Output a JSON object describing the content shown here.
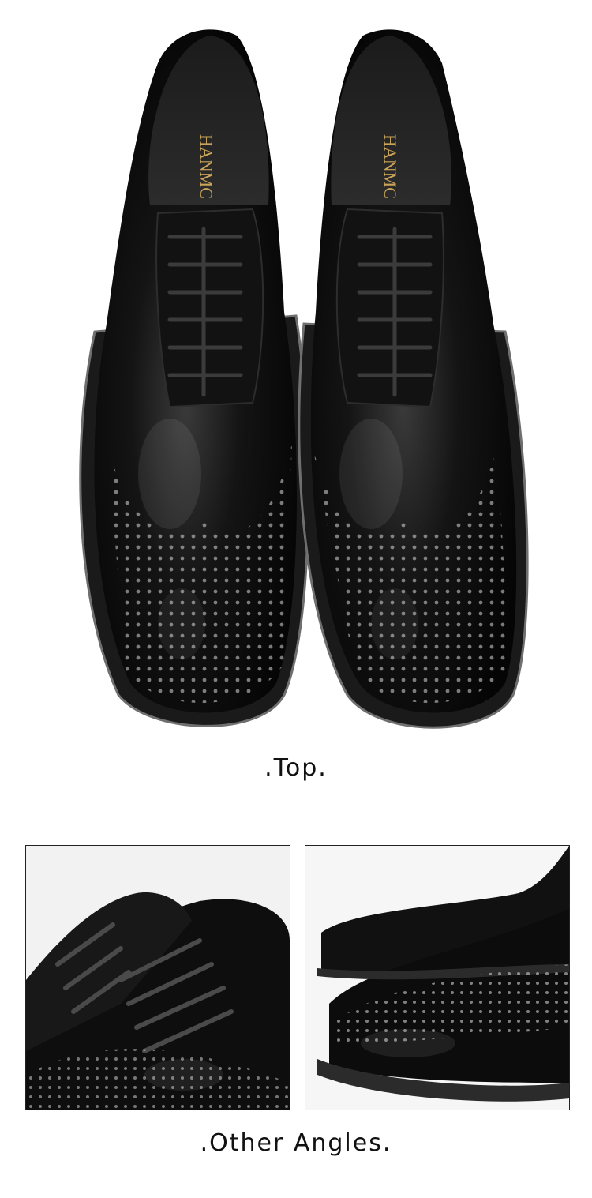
{
  "sections": {
    "top_caption": ".Top.",
    "angles_caption": ".Other Angles."
  },
  "insole_brand": "HANMC",
  "colors": {
    "shoe": "#0d0d0d",
    "highlight": "#8a8a8a",
    "insole_gold": "#c9a45a",
    "background": "#ffffff"
  }
}
